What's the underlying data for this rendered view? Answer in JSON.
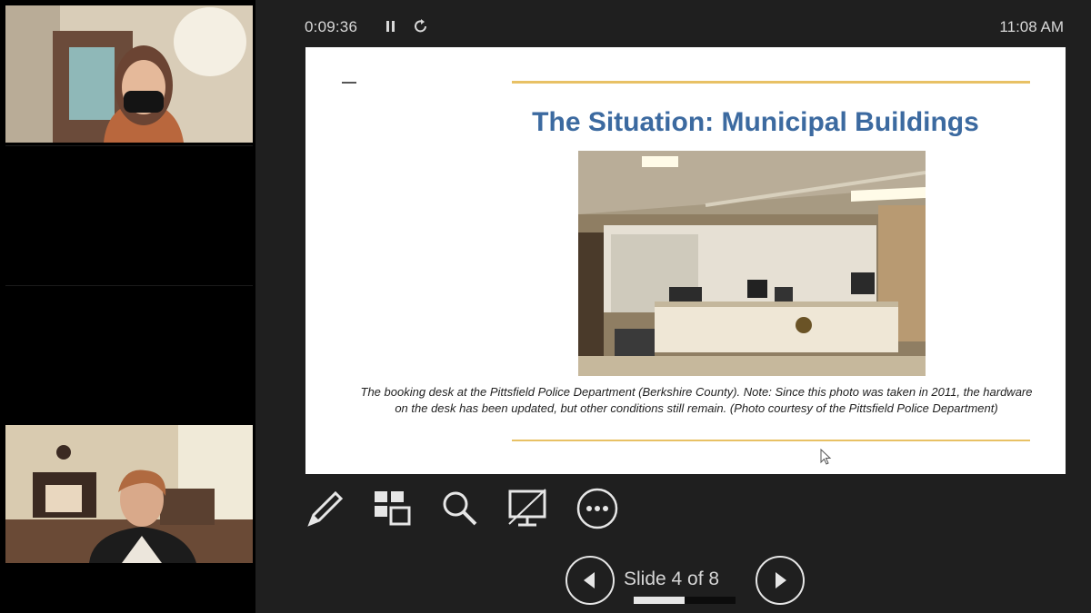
{
  "presenter": {
    "timer": "0:09:36",
    "clock": "11:08 AM",
    "slide": {
      "title": "The Situation: Municipal Buildings",
      "caption": "The booking desk at the Pittsfield Police Department (Berkshire County). Note: Since this photo was taken in 2011, the hardware on the desk has been updated, but other conditions still remain. (Photo courtesy of the Pittsfield Police Department)"
    },
    "tools": [
      "pen-tool-icon",
      "see-all-slides-icon",
      "zoom-icon",
      "black-screen-icon",
      "more-options-icon"
    ],
    "navigation": {
      "counter": "Slide 4 of 8",
      "progress_fraction": 0.5
    }
  },
  "participants": [
    {
      "state": "video",
      "description_icon": "participant-video-icon"
    },
    {
      "state": "camera-off"
    },
    {
      "state": "camera-off"
    },
    {
      "state": "video",
      "description_icon": "participant-video-icon"
    }
  ],
  "colors": {
    "title_blue": "#3c6aa0",
    "rule_gold": "#e8c165",
    "background": "#1f1f1f"
  }
}
